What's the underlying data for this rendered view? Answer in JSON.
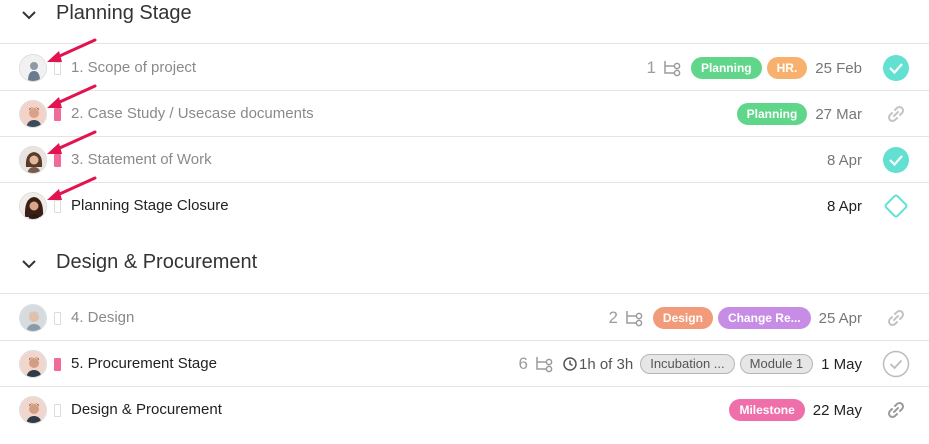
{
  "colors": {
    "planning": "#5fd68a",
    "hr": "#f7b16c",
    "design": "#f29b7a",
    "change": "#c78de6",
    "milestone": "#ee6fa9",
    "teal": "#62e1d2",
    "priority_pink": "#f06b9a",
    "arrow_red": "#e2134f"
  },
  "groups": [
    {
      "title": "Planning Stage",
      "tasks": [
        {
          "name": "1. Scope of project",
          "subtasks": "1",
          "tags": [
            "Planning",
            "HR."
          ],
          "date": "25 Feb"
        },
        {
          "name": "2. Case Study / Usecase documents",
          "tags": [
            "Planning"
          ],
          "date": "27 Mar"
        },
        {
          "name": "3. Statement of Work",
          "date": "8 Apr"
        },
        {
          "name": "Planning Stage Closure",
          "date": "8 Apr"
        }
      ]
    },
    {
      "title": "Design & Procurement",
      "tasks": [
        {
          "name": "4. Design",
          "subtasks": "2",
          "tags": [
            "Design",
            "Change Re..."
          ],
          "date": "25 Apr"
        },
        {
          "name": "5. Procurement Stage",
          "subtasks": "6",
          "time": "1h of 3h",
          "tags": [
            "Incubation ...",
            "Module 1"
          ],
          "date": "1 May"
        },
        {
          "name": "Design & Procurement",
          "tags": [
            "Milestone"
          ],
          "date": "22 May"
        }
      ]
    }
  ]
}
